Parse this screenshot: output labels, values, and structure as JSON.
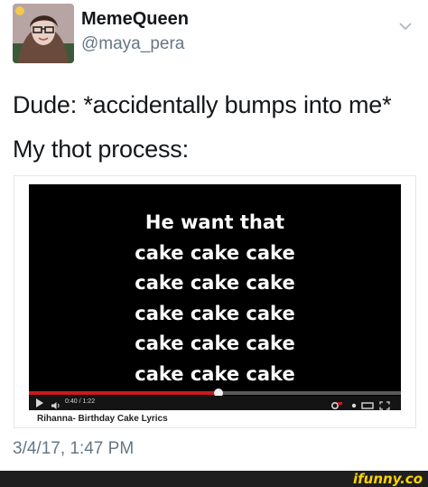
{
  "tweet": {
    "display_name": "MemeQueen",
    "handle": "@maya_pera",
    "line1": "Dude: *accidentally bumps into me*",
    "line2": "My thot process:",
    "timestamp": "3/4/17, 1:47 PM"
  },
  "video": {
    "lyrics": [
      "He want that",
      "cake cake cake",
      "cake cake cake",
      "cake cake cake",
      "cake cake cake",
      "cake cake cake"
    ],
    "time": "0:40 / 1:22",
    "progress": 0.51,
    "title": "Rihanna- Birthday Cake Lyrics"
  },
  "colors": {
    "progress_red": "#cc181e",
    "secondary_text": "#657786",
    "brand_yellow": "#ffd400"
  },
  "icons": {
    "menu": "chevron-down-icon",
    "play": "play-icon",
    "volume": "volume-icon",
    "settings": "gear-icon",
    "size": "theater-mode-icon",
    "fullscreen": "fullscreen-icon"
  },
  "footer": {
    "brand": "ifunny.co"
  }
}
